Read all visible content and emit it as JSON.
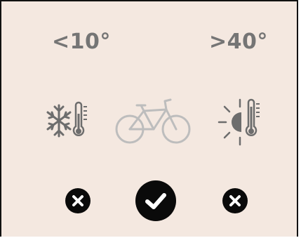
{
  "temperatures": {
    "cold_label": "<10°",
    "hot_label": ">40°"
  },
  "icons": {
    "cold": "snowflake-thermometer-icon",
    "bike": "bicycle-icon",
    "hot": "sun-thermometer-icon"
  },
  "status": {
    "cold": "x-mark-icon",
    "moderate": "checkmark-icon",
    "hot": "x-mark-icon"
  },
  "colors": {
    "background": "#f4e8e0",
    "label_text": "#757575",
    "icon_dark": "#6d6d6d",
    "icon_light": "#bdbdbd",
    "badge": "#0a0a0a"
  }
}
